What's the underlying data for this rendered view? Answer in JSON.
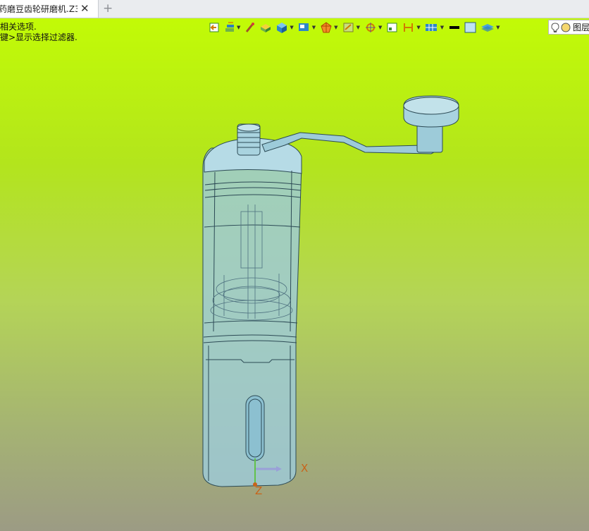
{
  "document_tab": {
    "title": "药磨豆齿轮研磨机.Z3",
    "close_glyph": "✕",
    "new_tab_glyph": "+"
  },
  "prompt_lines": [
    "相关选项.",
    "键>显示选择过滤器."
  ],
  "toolbar": {
    "icons": [
      "exit-sketch-icon",
      "layers-icon",
      "paint-brush-icon",
      "shaded-box-icon",
      "solid-cube-icon",
      "view-display-icon",
      "render-mode-icon",
      "sketch-plane-icon",
      "datum-point-icon",
      "bounding-box-icon",
      "dimension-icon",
      "grid-display-icon",
      "black-fill-swatch",
      "light-blue-swatch",
      "layer-stack-icon"
    ],
    "layer_field": {
      "value": "图层",
      "icons": [
        "lightbulb-icon",
        "layer-color-dot-icon"
      ]
    }
  },
  "axis_labels": {
    "x": "X",
    "z": "Z"
  },
  "colors": {
    "viewport_top": "#c2fb06",
    "viewport_bottom": "#9c9b84",
    "model_fill": "#9dcbd9",
    "model_edge": "#2c4a55",
    "axis_orange": "#c8641a"
  }
}
